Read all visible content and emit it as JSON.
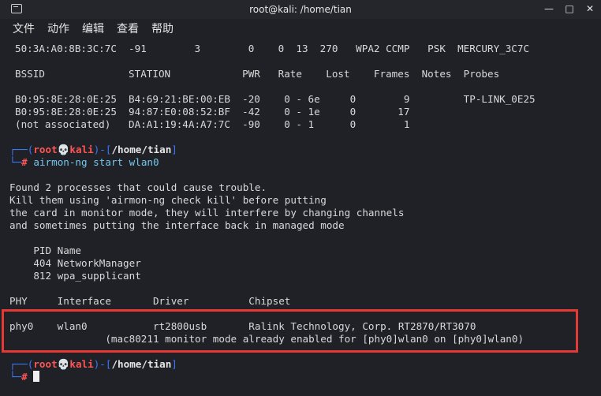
{
  "window": {
    "title": "root@kali: /home/tian",
    "buttons": {
      "minimize": "—",
      "maximize": "□",
      "close": "✕"
    }
  },
  "menu": [
    "文件",
    "动作",
    "编辑",
    "查看",
    "帮助"
  ],
  "terminal": {
    "scan_row": "50:3A:A0:8B:3C:7C  -91        3        0    0  13  270   WPA2 CCMP   PSK  MERCURY_3C7C",
    "station_header": "BSSID              STATION            PWR   Rate    Lost    Frames  Notes  Probes",
    "stations": [
      "B0:95:8E:28:0E:25  B4:69:21:BE:00:EB  -20    0 - 6e     0        9         TP-LINK_0E25",
      "B0:95:8E:28:0E:25  94:87:E0:08:52:BF  -42    0 - 1e     0       17",
      "(not associated)   DA:A1:19:4A:A7:7C  -90    0 - 1      0        1"
    ],
    "prompt1": {
      "user": "root",
      "skull": "💀",
      "host": "kali",
      "path": "/home/tian",
      "hash": "#",
      "command": "airmon-ng start wlan0"
    },
    "output": [
      "Found 2 processes that could cause trouble.",
      "Kill them using 'airmon-ng check kill' before putting",
      "the card in monitor mode, they will interfere by changing channels",
      "and sometimes putting the interface back in managed mode"
    ],
    "process_header": "    PID Name",
    "processes": [
      "    404 NetworkManager",
      "    812 wpa_supplicant"
    ],
    "iface_header": "PHY     Interface       Driver          Chipset",
    "iface_row": "phy0    wlan0           rt2800usb       Ralink Technology, Corp. RT2870/RT3070",
    "iface_note": "                (mac80211 monitor mode already enabled for [phy0]wlan0 on [phy0]wlan0)",
    "prompt2": {
      "user": "root",
      "skull": "💀",
      "host": "kali",
      "path": "/home/tian",
      "hash": "#"
    }
  }
}
